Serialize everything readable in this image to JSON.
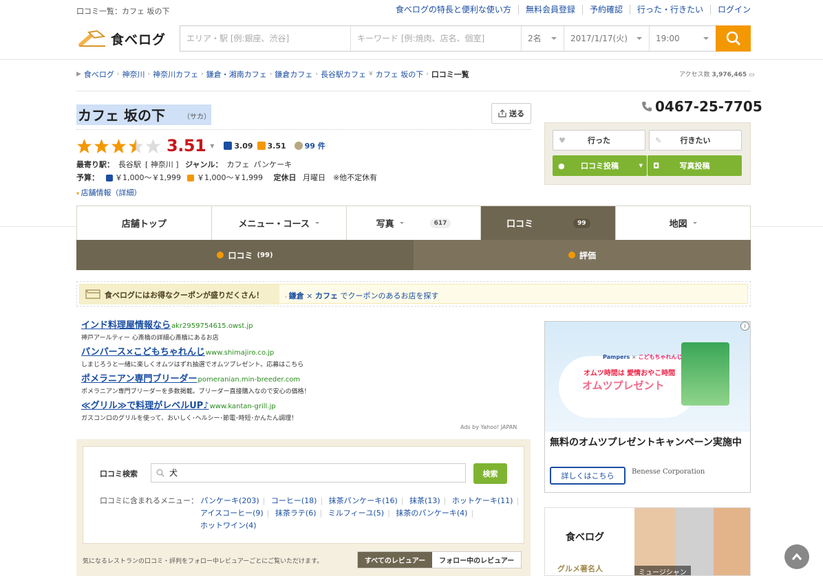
{
  "topbar": {
    "page_name": "口コミ一覧：カフェ 坂の下",
    "links": [
      "食べログの特長と便利な使い方",
      "無料会員登録",
      "予約確認",
      "行った・行きたい",
      "ログイン"
    ]
  },
  "header": {
    "logo_text": "食べログ",
    "area_placeholder": "エリア・駅 [例:銀座、渋谷]",
    "keyword_placeholder": "キーワード [例:焼肉、店名、個室]",
    "people": "2名",
    "date": "2017/1/17(火)",
    "time": "19:00"
  },
  "breadcrumb": {
    "items": [
      "食べログ",
      "神奈川",
      "神奈川カフェ",
      "鎌倉・湘南カフェ",
      "鎌倉カフェ",
      "長谷駅カフェ",
      "カフェ 坂の下"
    ],
    "current": "口コミ一覧",
    "access_label": "アクセス数",
    "access_count": "3,976,465"
  },
  "restaurant": {
    "name": "カフェ 坂の下",
    "ruby": "（サカ）",
    "send_label": "送る",
    "rating": 3.51,
    "rating_text": "3.51",
    "dinner_score": "3.09",
    "lunch_score": "3.51",
    "review_count": "99 件",
    "station_label": "最寄り駅：",
    "station": "長谷駅",
    "pref": "[ 神奈川 ]",
    "genre_label": "ジャンル：",
    "genre1": "カフェ",
    "genre2": "パンケーキ",
    "budget_label": "予算：",
    "budget_dinner": "￥1,000～￥1,999",
    "budget_lunch": "￥1,000～￥1,999",
    "holiday_label": "定休日",
    "holiday": "月曜日　※他不定休有",
    "detail_link": "店舗情報（詳細）"
  },
  "side": {
    "phone": "0467-25-7705",
    "went": "行った",
    "want": "行きたい",
    "post_review": "口コミ投稿",
    "post_photo": "写真投稿"
  },
  "tabs": [
    {
      "label": "店舗トップ",
      "count": "",
      "dd": false,
      "active": false
    },
    {
      "label": "メニュー・コース",
      "count": "",
      "dd": true,
      "active": false
    },
    {
      "label": "写真",
      "count": "617",
      "dd": true,
      "active": false
    },
    {
      "label": "口コミ",
      "count": "99",
      "dd": false,
      "active": true
    },
    {
      "label": "地図",
      "count": "",
      "dd": true,
      "active": false
    }
  ],
  "subtabs": {
    "reviews": "口コミ",
    "reviews_count": "(99)",
    "ratings": "評価"
  },
  "coupon": {
    "left": "食べログにはお得なクーポンが盛りだくさん！",
    "area": "鎌倉",
    "times": "×",
    "genre": "カフェ",
    "suffix": "でクーポンのあるお店を探す"
  },
  "ads": [
    {
      "title": "インド料理屋情報なら",
      "url": "akr2959754615.owst.jp",
      "desc": "神戸アールティー 心斎橋の詳細心斎橋にあるお店"
    },
    {
      "title": "パンパース×こどもちゃれんじ",
      "url": "www.shimajiro.co.jp",
      "desc": "しまじろうと一緒に楽しくオムツはずれ抽選でオムツプレゼント。応募はこちら"
    },
    {
      "title": "ポメラニアン専門ブリーダー",
      "url": "pomeranian.min-breeder.com",
      "desc": "ポメラニアン専門ブリーダーを多数掲載。ブリーダー直接購入なので安心の価格！"
    },
    {
      "title": "≪グリル≫で料理がレベルUP♪",
      "url": "www.kantan-grill.jp",
      "desc": "ガスコンロのグリルを使って、おいしく･ヘルシー･節電･時短･かんたん調理！"
    }
  ],
  "ads_by": "Ads by Yahoo! JAPAN",
  "review_search": {
    "label": "口コミ検索",
    "value": "犬",
    "button": "検索",
    "menu_label": "口コミに含まれるメニュー：",
    "menus": [
      "パンケーキ(203)",
      "コーヒー(18)",
      "抹茶パンケーキ(16)",
      "抹茶(13)",
      "ホットケーキ(11)",
      "アイスコーヒー(9)",
      "抹茶ラテ(6)",
      "ミルフィーユ(5)",
      "抹茶のパンケーキ(4)",
      "ホットワイン(4)"
    ],
    "follow_text": "気になるレストランの口コミ・評判をフォロー中レビュアーごとにご覧いただけます。",
    "all_reviewers": "すべてのレビュアー",
    "following_reviewers": "フォロー中のレビュアー"
  },
  "banner": {
    "brand1": "Pampers",
    "times": "×",
    "brand2": "こどもちゃれんじ",
    "copy1": "オムツ時間は 愛情おやこ時間",
    "copy2": "オムツプレゼント",
    "headline": "無料のオムツプレゼントキャンペーン実施中",
    "more": "詳しくはこちら",
    "company": "Benesse Corporation"
  },
  "banner2": {
    "logo": "食べログ",
    "sub": "グルメ著名人",
    "caption": "ミュージシャン"
  },
  "colors": {
    "accent_orange": "#f39800",
    "tab_brown": "#6f6651",
    "score_red": "#c8161d",
    "link_blue": "#1a4ea2",
    "green": "#7fb432"
  }
}
